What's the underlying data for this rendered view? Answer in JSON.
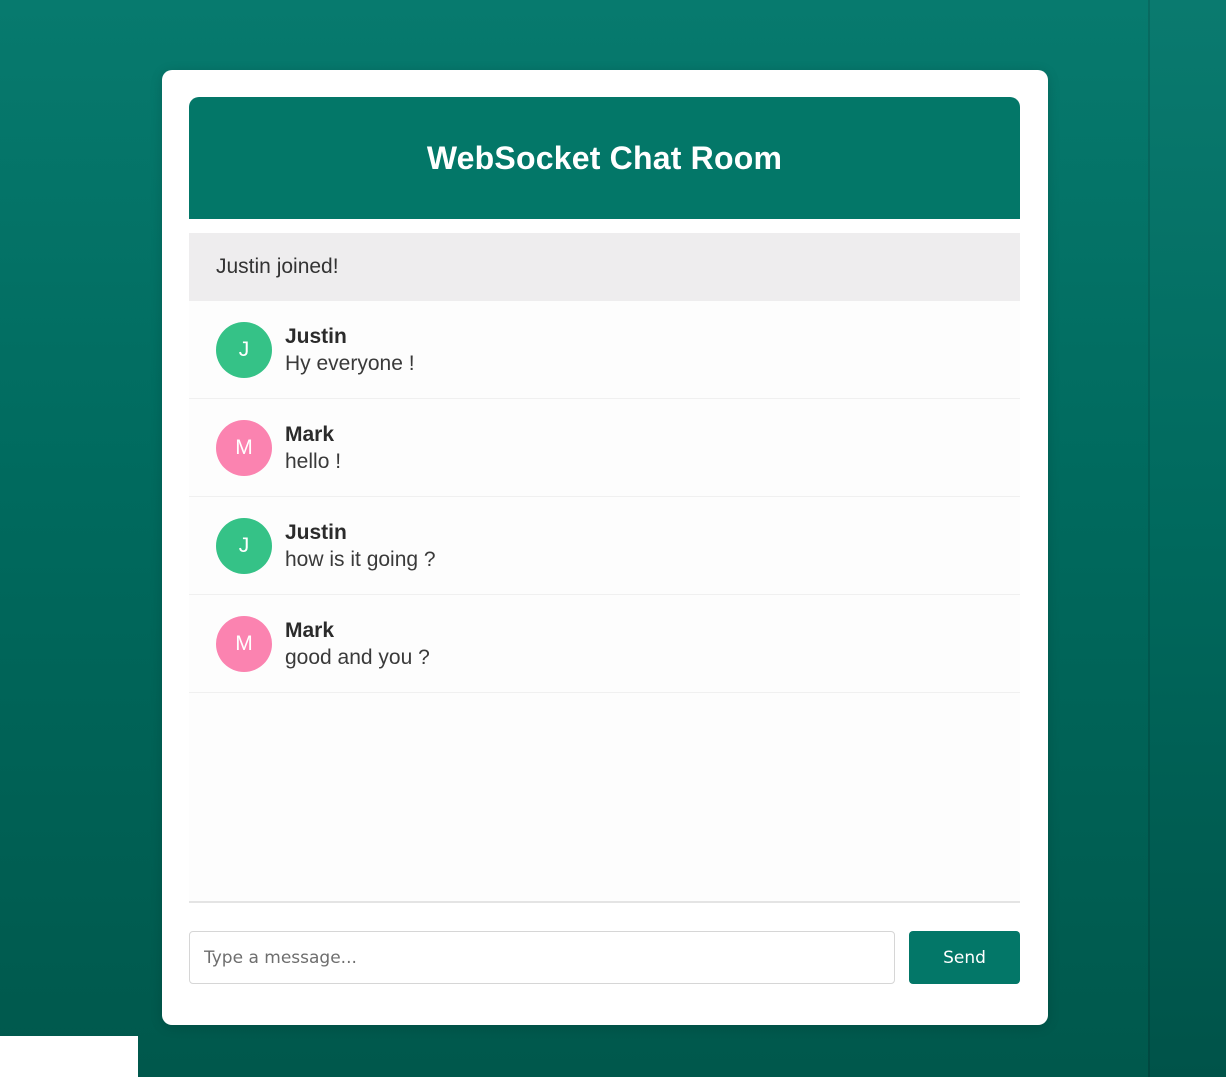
{
  "app": {
    "title": "WebSocket Chat Room"
  },
  "system_message": "Justin joined!",
  "messages": [
    {
      "initial": "J",
      "user": "Justin",
      "text": "Hy everyone !",
      "avatar_color": "#35c287"
    },
    {
      "initial": "M",
      "user": "Mark",
      "text": "hello !",
      "avatar_color": "#fb83b0"
    },
    {
      "initial": "J",
      "user": "Justin",
      "text": "how is it going ?",
      "avatar_color": "#35c287"
    },
    {
      "initial": "M",
      "user": "Mark",
      "text": "good and you ?",
      "avatar_color": "#fb83b0"
    }
  ],
  "composer": {
    "placeholder": "Type a message...",
    "value": "",
    "send_label": "Send"
  },
  "colors": {
    "accent": "#037768",
    "background": "#006a5e",
    "system_bg": "#eeedee"
  }
}
